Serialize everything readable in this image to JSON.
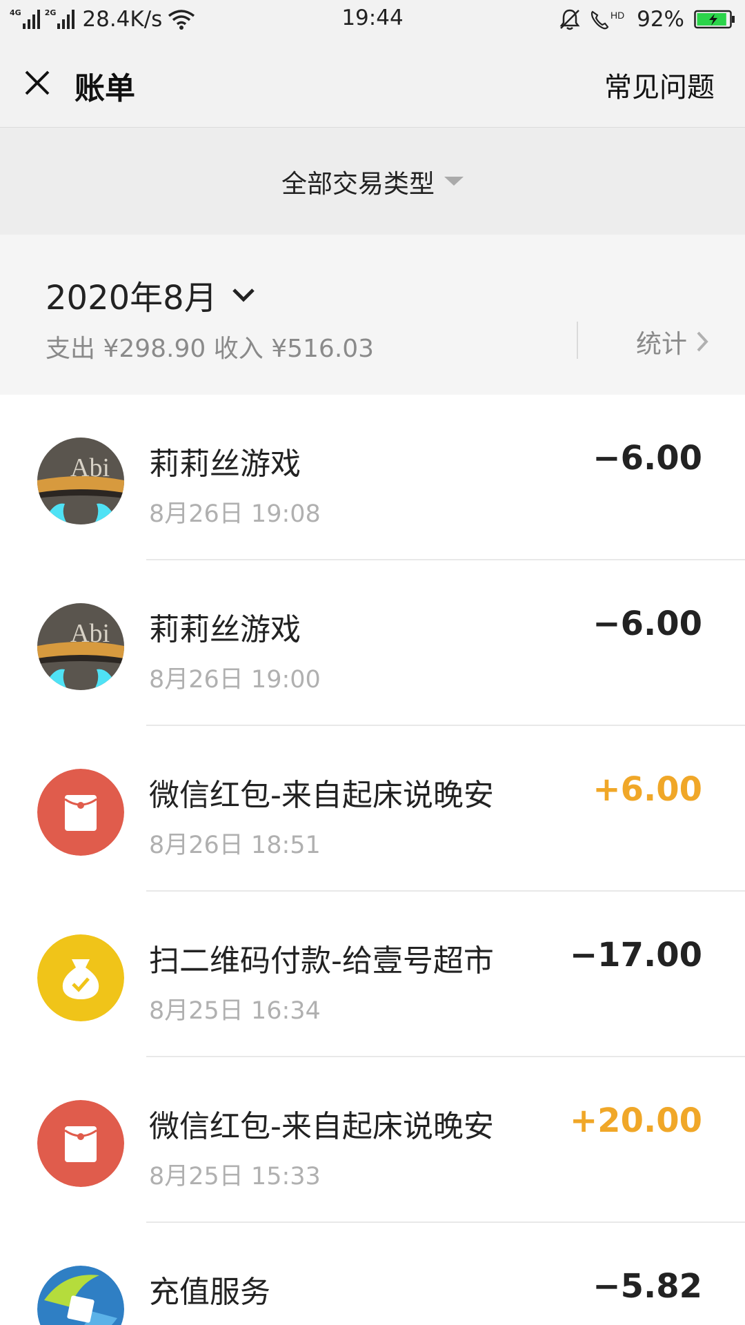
{
  "status_bar": {
    "net_left": "4G",
    "net_right": "2G",
    "speed": "28.4K/s",
    "time": "19:44",
    "hd": "HD",
    "battery_pct": "92%",
    "battery_level": 0.92
  },
  "nav": {
    "title": "账单",
    "faq": "常见问题"
  },
  "filter": {
    "label": "全部交易类型"
  },
  "month": {
    "title": "2020年8月",
    "summary": "支出 ¥298.90 收入 ¥516.03",
    "stats_label": "统计"
  },
  "transactions": [
    {
      "name": "莉莉丝游戏",
      "time": "8月26日 19:08",
      "amount": "−6.00",
      "type": "expense",
      "icon": "game-app-icon"
    },
    {
      "name": "莉莉丝游戏",
      "time": "8月26日 19:00",
      "amount": "−6.00",
      "type": "expense",
      "icon": "game-app-icon"
    },
    {
      "name": "微信红包-来自起床说晚安",
      "time": "8月26日 18:51",
      "amount": "+6.00",
      "type": "income",
      "icon": "red-packet-icon"
    },
    {
      "name": "扫二维码付款-给壹号超市",
      "time": "8月25日 16:34",
      "amount": "−17.00",
      "type": "expense",
      "icon": "money-bag-icon"
    },
    {
      "name": "微信红包-来自起床说晚安",
      "time": "8月25日 15:33",
      "amount": "+20.00",
      "type": "income",
      "icon": "red-packet-icon"
    },
    {
      "name": "充值服务",
      "time": "",
      "amount": "−5.82",
      "type": "expense",
      "icon": "recharge-service-icon"
    }
  ],
  "colors": {
    "income": "#f0a728",
    "red_packet": "#e05c4c",
    "money_bag": "#f0c419"
  },
  "game_logo_text": "Abi"
}
